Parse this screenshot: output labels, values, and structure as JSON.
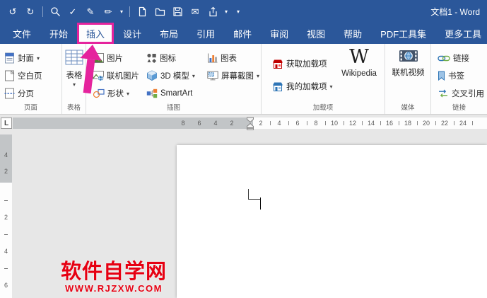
{
  "colors": {
    "titlebar_blue": "#2B579A",
    "highlight_magenta": "#E5239D",
    "watermark_red": "#E60012"
  },
  "titlebar": {
    "title": "文档1 - Word"
  },
  "ui": {
    "caret": "▾",
    "undo": "↺",
    "redo": "↻",
    "check": "✓",
    "pencil": "✎",
    "pen": "✏",
    "envelope": "✉"
  },
  "tabs": [
    "文件",
    "开始",
    "插入",
    "设计",
    "布局",
    "引用",
    "邮件",
    "审阅",
    "视图",
    "帮助",
    "PDF工具集",
    "更多工具"
  ],
  "active_tab": "插入",
  "ribbon": {
    "pages": {
      "label": "页面",
      "cover": "封面",
      "blank": "空白页",
      "break": "分页"
    },
    "table": {
      "label": "表格",
      "button": "表格"
    },
    "illustrations": {
      "label": "插图",
      "pictures": "图片",
      "online_pictures": "联机图片",
      "shapes": "形状",
      "icons": "图标",
      "models": "3D 模型",
      "smartart": "SmartArt",
      "chart": "图表",
      "screenshot": "屏幕截图"
    },
    "addins": {
      "label": "加载项",
      "get": "获取加载项",
      "my": "我的加载项",
      "wikipedia": "Wikipedia",
      "wikipedia_w": "W"
    },
    "media": {
      "label": "媒体",
      "video": "联机视频"
    },
    "links": {
      "label": "链接",
      "link": "链接",
      "bookmark": "书签",
      "crossref": "交叉引用"
    }
  },
  "ruler": {
    "tab_selector": "L",
    "margin_numbers": [
      "8",
      "6",
      "4",
      "2"
    ],
    "page_numbers": [
      "2",
      "4",
      "6",
      "8",
      "10",
      "12",
      "14",
      "16",
      "18",
      "20",
      "22",
      "24"
    ],
    "vertical_dark": [
      "4",
      "2"
    ],
    "vertical_light": [
      "2",
      "4",
      "6"
    ]
  },
  "document": {
    "watermark_title": "软件自学网",
    "watermark_url": "WWW.RJZXW.COM"
  }
}
